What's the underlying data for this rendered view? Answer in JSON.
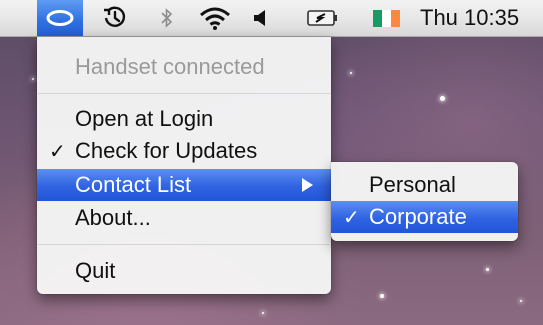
{
  "menubar": {
    "clock": "Thu 10:35",
    "icons": {
      "app": "oval-status-icon",
      "time_machine": "time-machine-icon",
      "bluetooth": "bluetooth-icon",
      "wifi": "wifi-icon",
      "volume": "volume-icon",
      "battery": "battery-charging-icon",
      "flag": "ireland-flag-icon"
    },
    "flag_colors": [
      "#169b62",
      "#ffffff",
      "#ff883e"
    ],
    "highlight_color": "#2f63e2"
  },
  "menu": {
    "status": "Handset connected",
    "open_login": "Open at Login",
    "check_updates": "Check for Updates",
    "check_updates_checked": "✓",
    "contact_list": "Contact List",
    "about": "About...",
    "quit": "Quit"
  },
  "submenu": {
    "personal": "Personal",
    "corporate": "Corporate",
    "corporate_checked": "✓"
  }
}
